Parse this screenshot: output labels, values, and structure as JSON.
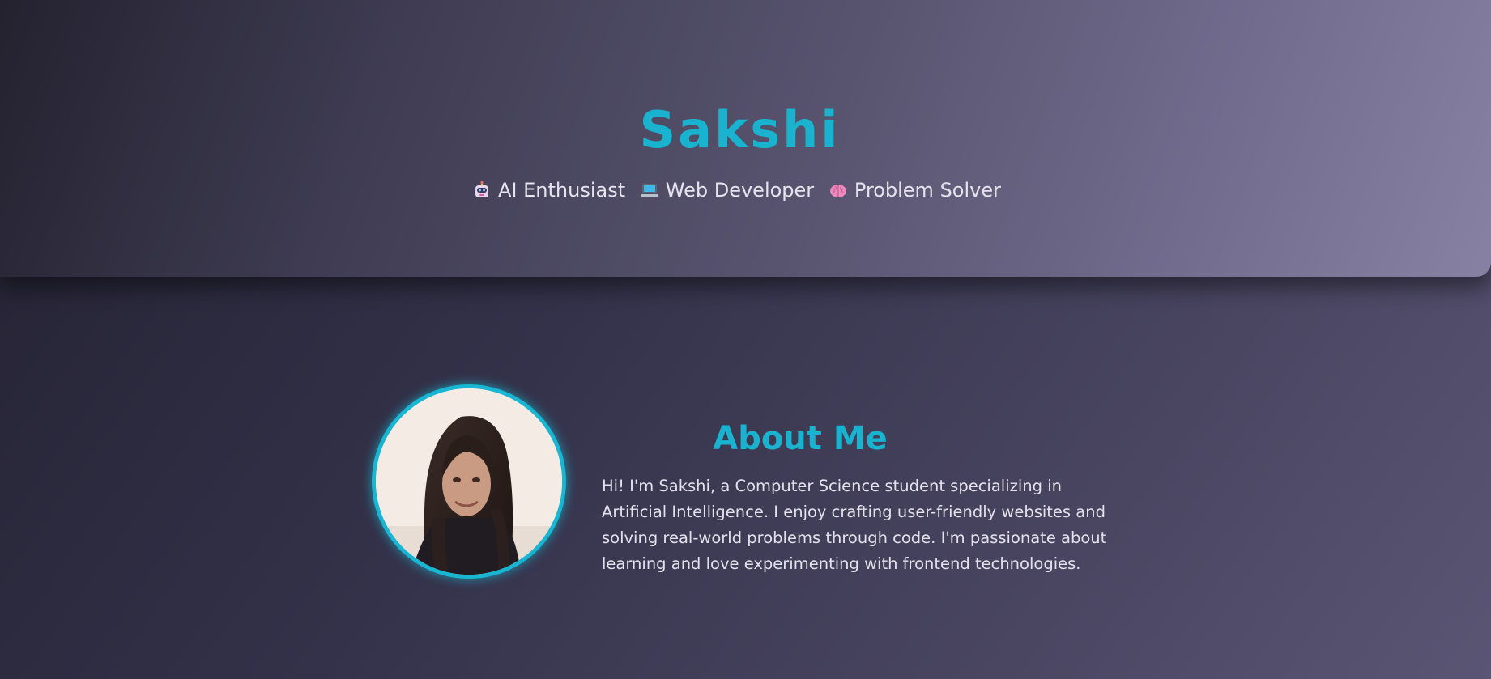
{
  "hero": {
    "title": "Sakshi",
    "tagline": [
      {
        "icon": "robot-icon",
        "text": "AI Enthusiast"
      },
      {
        "icon": "laptop-icon",
        "text": "Web Developer"
      },
      {
        "icon": "brain-icon",
        "text": "Problem Solver"
      }
    ]
  },
  "about": {
    "title": "About Me",
    "text": "Hi! I'm Sakshi, a Computer Science student specializing in Artificial Intelligence. I enjoy crafting user-friendly websites and solving real-world problems through code. I'm passionate about learning and love experimenting with frontend technologies.",
    "avatar_alt": "profile-photo"
  },
  "colors": {
    "accent": "#1ab3cf",
    "text": "#e6e3ee",
    "hero_start": "#24222f",
    "hero_end": "#8781a4"
  }
}
